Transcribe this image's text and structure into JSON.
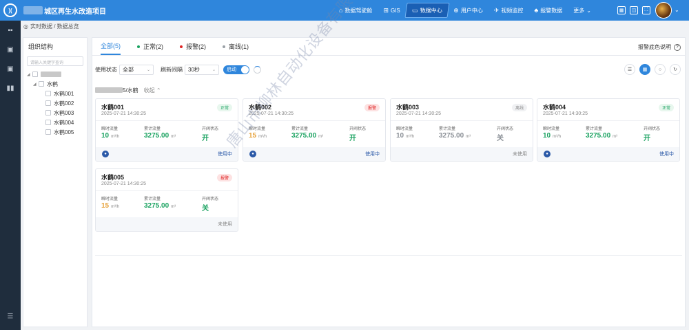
{
  "header": {
    "app_title": "城区再生水改造项目",
    "nav": [
      {
        "icon": "dashboard-icon",
        "glyph": "⌂",
        "label": "数据驾驶舱"
      },
      {
        "icon": "gis-icon",
        "glyph": "⊞",
        "label": "GIS"
      },
      {
        "icon": "data-center-icon",
        "glyph": "▭",
        "label": "数据中心"
      },
      {
        "icon": "user-center-icon",
        "glyph": "⊕",
        "label": "用户中心"
      },
      {
        "icon": "video-icon",
        "glyph": "✈",
        "label": "视频监控"
      },
      {
        "icon": "alarm-icon",
        "glyph": "♣",
        "label": "报警数据"
      },
      {
        "icon": "more-icon",
        "glyph": "",
        "label": "更多"
      }
    ],
    "more_caret": "⌄"
  },
  "breadcrumb": {
    "path": "实时数据 / 数据总览"
  },
  "tree": {
    "title": "组织结构",
    "search_placeholder": "请输入关键字查询",
    "folder_label": "水鹤",
    "items": [
      "水鹤001",
      "水鹤002",
      "水鹤003",
      "水鹤004",
      "水鹤005"
    ]
  },
  "tabs": {
    "items": [
      {
        "label": "全部(5)",
        "dot": ""
      },
      {
        "label": "正常(2)",
        "dot": "#1aa260"
      },
      {
        "label": "报警(2)",
        "dot": "#e02424"
      },
      {
        "label": "离线(1)",
        "dot": "#9aa0a6"
      }
    ],
    "legend_link": "报警底色说明",
    "legend_help": "?"
  },
  "toolbar": {
    "status_label": "使用状态",
    "status_value": "全部",
    "refresh_label": "刷新间隔",
    "refresh_value": "30秒",
    "toggle_label": "启动"
  },
  "group": {
    "suffix": "5/水鹤",
    "collapse": "收起"
  },
  "card_labels": {
    "instant": "瞬时流量",
    "total": "累计流量",
    "valve": "开阀状态",
    "instant_unit": "m³/h",
    "total_unit": "m³"
  },
  "cards": [
    {
      "name": "水鹤001",
      "time": "2025-07-21 14:30:25",
      "badge": "正常",
      "badge_style": "normal",
      "instant": "10",
      "instant_color": "#1aa260",
      "total": "3275.00",
      "total_color": "#1aa260",
      "valve": "开",
      "valve_color": "#1aa260",
      "usage": "使用中",
      "usage_color": "#2c5aa8",
      "has_user": true
    },
    {
      "name": "水鹤002",
      "time": "2025-07-21 14:30:25",
      "badge": "报警",
      "badge_style": "alarm",
      "instant": "15",
      "instant_color": "#e6a23c",
      "total": "3275.00",
      "total_color": "#1aa260",
      "valve": "开",
      "valve_color": "#1aa260",
      "usage": "使用中",
      "usage_color": "#2c5aa8",
      "has_user": true
    },
    {
      "name": "水鹤003",
      "time": "2025-07-21 14:30:25",
      "badge": "离线",
      "badge_style": "offline",
      "instant": "10",
      "instant_color": "#8a8f96",
      "total": "3275.00",
      "total_color": "#8a8f96",
      "valve": "关",
      "valve_color": "#8a8f96",
      "usage": "未使用",
      "usage_color": "#888888",
      "has_user": false
    },
    {
      "name": "水鹤004",
      "time": "2025-07-21 14:30:25",
      "badge": "正常",
      "badge_style": "normal",
      "instant": "10",
      "instant_color": "#1aa260",
      "total": "3275.00",
      "total_color": "#1aa260",
      "valve": "开",
      "valve_color": "#1aa260",
      "usage": "使用中",
      "usage_color": "#2c5aa8",
      "has_user": true
    },
    {
      "name": "水鹤005",
      "time": "2025-07-21 14:30:25",
      "badge": "报警",
      "badge_style": "alarm",
      "instant": "15",
      "instant_color": "#e6a23c",
      "total": "3275.00",
      "total_color": "#1aa260",
      "valve": "关",
      "valve_color": "#1aa260",
      "usage": "未使用",
      "usage_color": "#888888",
      "has_user": false
    }
  ],
  "watermark": "唐山市柳林自动化设备有限公司",
  "colors": {
    "accent": "#2f86dc",
    "sidebar": "#1f2d3d",
    "normal": "#1aa260",
    "alarm": "#e02424",
    "warn": "#e6a23c"
  }
}
